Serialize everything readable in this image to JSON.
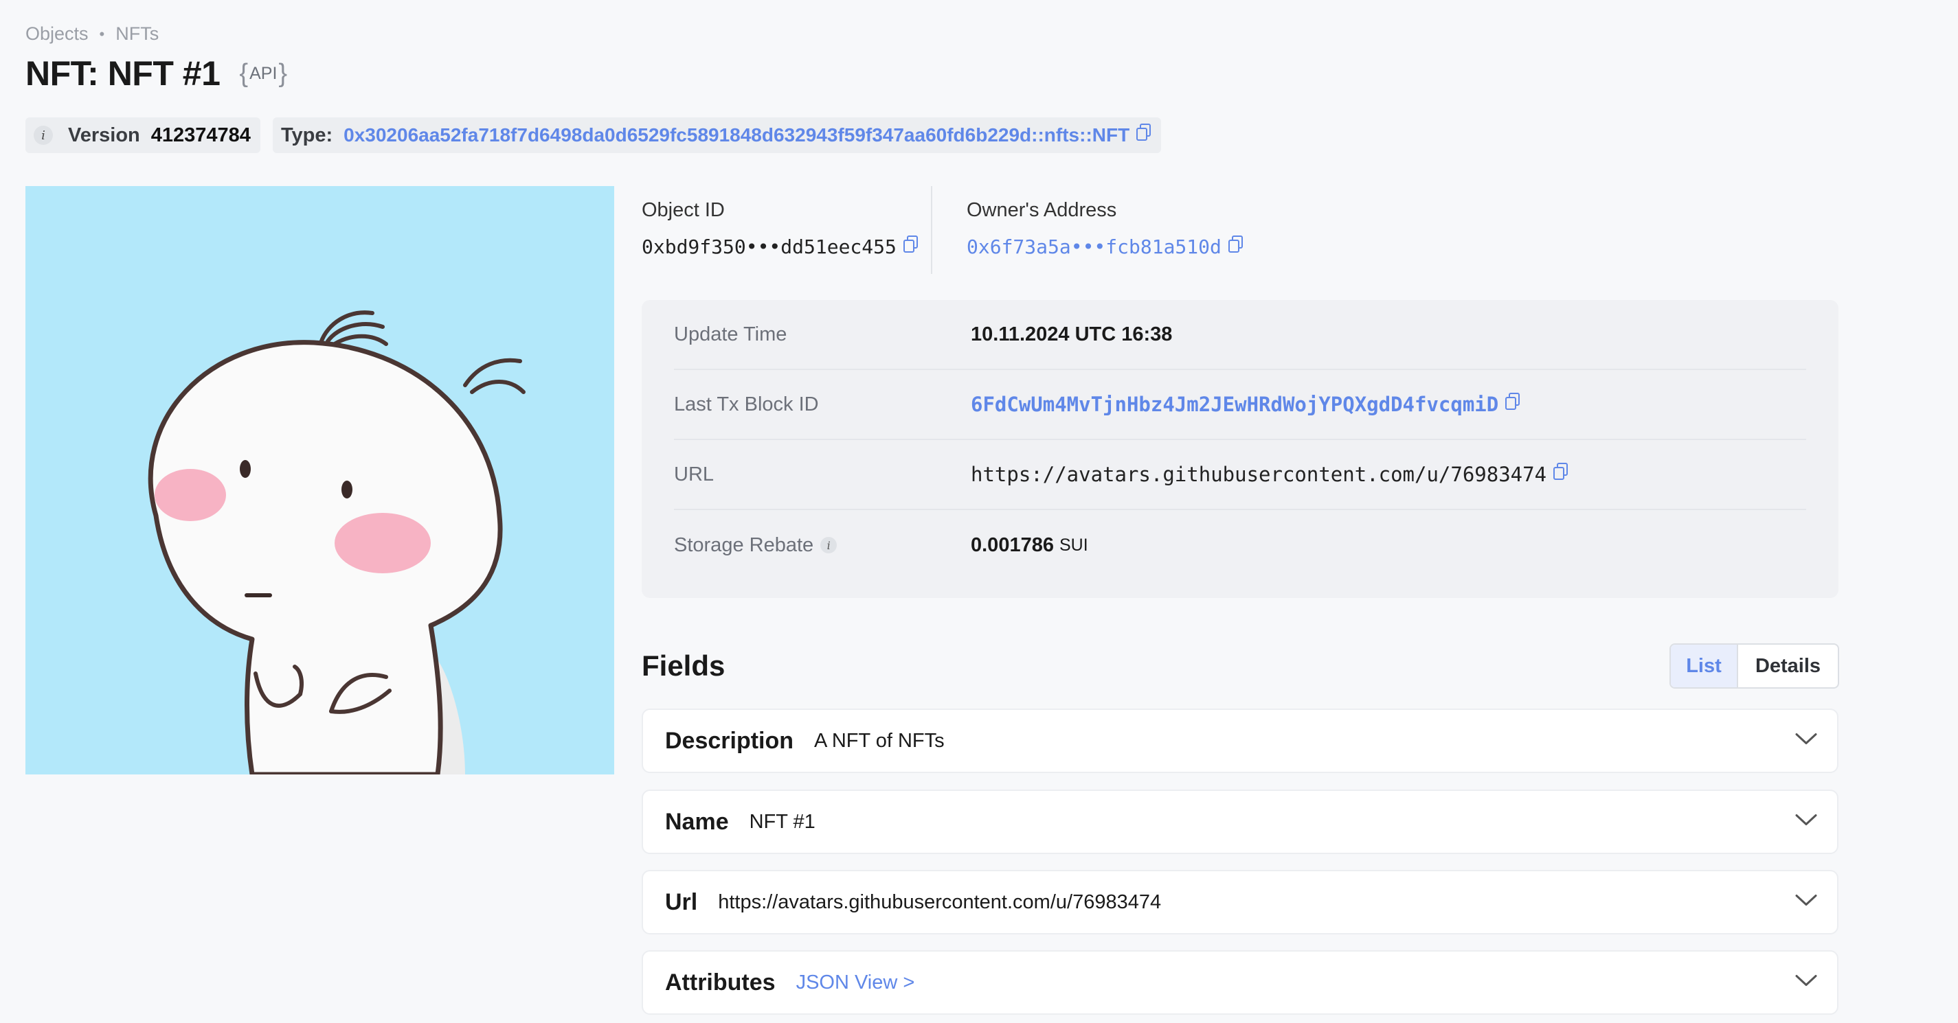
{
  "breadcrumb": {
    "objects": "Objects",
    "separator": "•",
    "nfts": "NFTs"
  },
  "title": "NFT: NFT #1",
  "api_badge": {
    "open": "{",
    "text": "API",
    "close": "}"
  },
  "version": {
    "label": "Version",
    "value": "412374784",
    "info": "i"
  },
  "type": {
    "label": "Type:",
    "value": "0x30206aa52fa718f7d6498da0d6529fc5891848d632943f59f347aa60fd6b229d::nfts::NFT"
  },
  "object_id": {
    "label": "Object ID",
    "value": "0xbd9f350•••dd51eec455"
  },
  "owner": {
    "label": "Owner's Address",
    "value": "0x6f73a5a•••fcb81a510d"
  },
  "details": {
    "update_time": {
      "label": "Update Time",
      "value": "10.11.2024 UTC 16:38"
    },
    "last_tx": {
      "label": "Last Tx Block ID",
      "value": "6FdCwUm4MvTjnHbz4Jm2JEwHRdWojYPQXgdD4fvcqmiD"
    },
    "url": {
      "label": "URL",
      "value": "https://avatars.githubusercontent.com/u/76983474"
    },
    "storage_rebate": {
      "label": "Storage Rebate",
      "value": "0.001786",
      "unit": "SUI",
      "info": "i"
    }
  },
  "fields": {
    "title": "Fields",
    "view_toggle": {
      "list": "List",
      "details": "Details",
      "selected": "List"
    },
    "items": [
      {
        "name": "Description",
        "value": "A NFT of NFTs"
      },
      {
        "name": "Name",
        "value": "NFT #1"
      },
      {
        "name": "Url",
        "value": "https://avatars.githubusercontent.com/u/76983474"
      },
      {
        "name": "Attributes",
        "value": "JSON View >"
      }
    ]
  },
  "colors": {
    "accent": "#5f87e8",
    "image_bg": "#b3e8fa",
    "page_bg": "#f7f8fa",
    "cheek": "#f7b3c4"
  },
  "icons": [
    "info-icon",
    "copy-icon",
    "chevron-down-icon"
  ]
}
